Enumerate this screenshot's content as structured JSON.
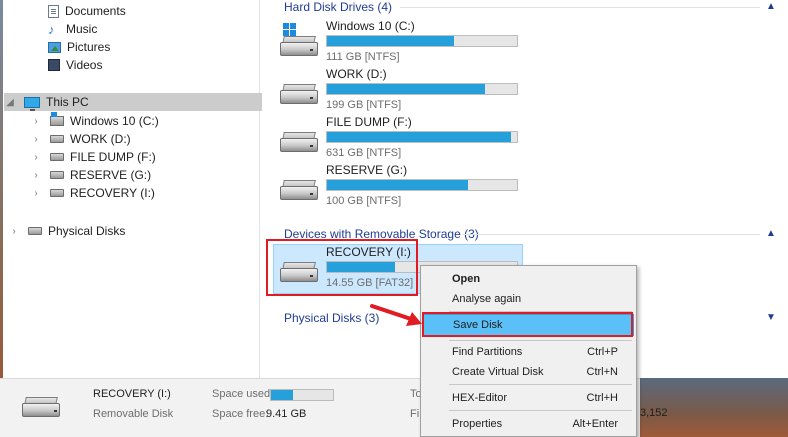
{
  "nav": {
    "quick_items": [
      {
        "label": "Documents",
        "icon": "document-icon"
      },
      {
        "label": "Music",
        "icon": "music-note-icon"
      },
      {
        "label": "Pictures",
        "icon": "picture-icon"
      },
      {
        "label": "Videos",
        "icon": "video-icon"
      }
    ],
    "this_pc": "This PC",
    "drives": [
      "Windows 10 (C:)",
      "WORK (D:)",
      "FILE DUMP (F:)",
      "RESERVE (G:)",
      "RECOVERY (I:)"
    ],
    "physical_disks": "Physical Disks"
  },
  "main": {
    "hard_disk_header": "Hard Disk Drives (4)",
    "hard_drives": [
      {
        "name": "Windows 10 (C:)",
        "info": "111 GB [NTFS]",
        "used_fraction": 0.67
      },
      {
        "name": "WORK (D:)",
        "info": "199 GB [NTFS]",
        "used_fraction": 0.83
      },
      {
        "name": "FILE DUMP (F:)",
        "info": "631 GB [NTFS]",
        "used_fraction": 0.97
      },
      {
        "name": "RESERVE (G:)",
        "info": "100 GB [NTFS]",
        "used_fraction": 0.74
      }
    ],
    "removable_header": "Devices with Removable Storage (3)",
    "removable_drive": {
      "name": "RECOVERY (I:)",
      "info": "14.55 GB [FAT32]",
      "used_fraction": 0.36
    },
    "physical_header": "Physical Disks (3)"
  },
  "details": {
    "name": "RECOVERY (I:)",
    "type": "Removable Disk",
    "space_used_label": "Space used:",
    "space_free_label": "Space free:",
    "space_free_value": "9.41 GB",
    "used_fraction": 0.36,
    "truncated_label_1": "To",
    "truncated_label_2": "Fi",
    "truncated_value": "3,152"
  },
  "context_menu": {
    "items": [
      {
        "label": "Open",
        "shortcut": ""
      },
      {
        "label": "Analyse again",
        "shortcut": ""
      },
      {
        "label": "Save Disk",
        "shortcut": ""
      },
      {
        "label": "Find Partitions",
        "shortcut": "Ctrl+P"
      },
      {
        "label": "Create Virtual Disk",
        "shortcut": "Ctrl+N"
      },
      {
        "label": "HEX-Editor",
        "shortcut": "Ctrl+H"
      },
      {
        "label": "Properties",
        "shortcut": "Alt+Enter"
      }
    ]
  },
  "colors": {
    "accent": "#26a0da",
    "highlight": "#5bc0f8",
    "annotation": "#e01b24",
    "header_blue": "#1e3c96"
  }
}
